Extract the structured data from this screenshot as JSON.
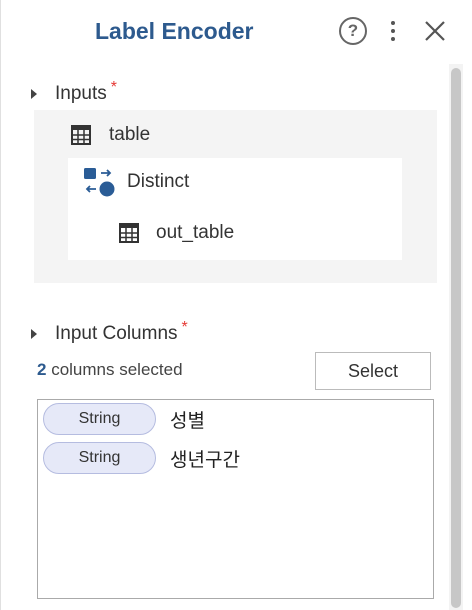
{
  "header": {
    "title": "Label Encoder",
    "help_glyph": "?"
  },
  "inputs_section": {
    "label": "Inputs",
    "required_mark": "*",
    "tree": {
      "table_label": "table",
      "node_label": "Distinct",
      "output_label": "out_table"
    }
  },
  "input_columns": {
    "label": "Input Columns",
    "required_mark": "*",
    "selected_count": "2",
    "selected_text": "columns selected",
    "select_button": "Select",
    "columns": [
      {
        "type": "String",
        "name": "성별"
      },
      {
        "type": "String",
        "name": "생년구간"
      }
    ]
  },
  "colors": {
    "title": "#2d5a8e",
    "required": "#e53935",
    "badge_bg": "#e6e9f8",
    "node_icon": "#2a5c96"
  },
  "icons": {
    "help": "help-circle-icon",
    "menu": "more-vertical-icon",
    "close": "close-icon",
    "table": "table-grid-icon",
    "distinct": "distinct-transform-icon"
  }
}
